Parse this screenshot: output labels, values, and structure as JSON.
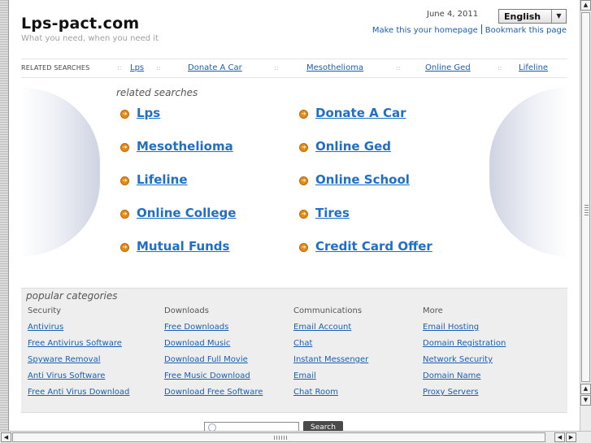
{
  "header": {
    "site_title": "Lps-pact.com",
    "tagline": "What you need, when you need it",
    "date": "June 4, 2011",
    "language": "English",
    "make_homepage": "Make this your homepage",
    "bookmark": "Bookmark this page"
  },
  "related_bar": {
    "label": "RELATED SEARCHES",
    "separator": "::",
    "links": [
      "Lps",
      "Donate A Car",
      "Mesothelioma",
      "Online Ged",
      "Lifeline"
    ]
  },
  "related_searches": {
    "title": "related searches",
    "left": [
      "Lps",
      "Mesothelioma",
      "Lifeline",
      "Online College",
      "Mutual Funds"
    ],
    "right": [
      "Donate A Car",
      "Online Ged",
      "Online School",
      "Tires",
      "Credit Card Offer"
    ]
  },
  "popular": {
    "title": "popular categories",
    "columns": [
      {
        "heading": "Security",
        "links": [
          "Antivirus",
          "Free Antivirus Software",
          "Spyware Removal",
          "Anti Virus Software",
          "Free Anti Virus Download"
        ]
      },
      {
        "heading": "Downloads",
        "links": [
          "Free Downloads",
          "Download Music",
          "Download Full Movie",
          "Free Music Download",
          "Download Free Software"
        ]
      },
      {
        "heading": "Communications",
        "links": [
          "Email Account",
          "Chat",
          "Instant Messenger",
          "Email",
          "Chat Room"
        ]
      },
      {
        "heading": "More",
        "links": [
          "Email Hosting",
          "Domain Registration",
          "Network Security",
          "Domain Name",
          "Proxy Servers"
        ]
      }
    ]
  },
  "search": {
    "button": "Search",
    "value": ""
  },
  "icons": {
    "keyword_arrow": "arrow-circle-icon",
    "search": "magnifier-icon",
    "dropdown": "triangle-down-icon"
  },
  "colors": {
    "link": "#1a5fb4",
    "keyword_link": "#1f6fc7",
    "arrow": "#e48a17",
    "panel_bg": "#eeeeee",
    "search_button": "#4a4a4a"
  }
}
